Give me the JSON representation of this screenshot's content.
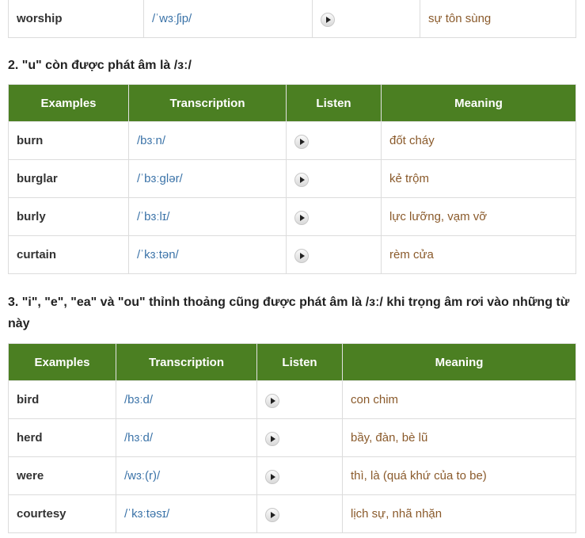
{
  "top_row": {
    "word": "worship",
    "ipa": "/ˈwɜːʃip/",
    "meaning": "sự tôn sùng"
  },
  "section2": {
    "heading": "2. \"u\" còn được phát âm là /ɜː/",
    "headers": [
      "Examples",
      "Transcription",
      "Listen",
      "Meaning"
    ],
    "rows": [
      {
        "word": "burn",
        "ipa": "/bɜːn/",
        "meaning": "đốt cháy"
      },
      {
        "word": "burglar",
        "ipa": "/ˈbɜːglər/",
        "meaning": "kẻ trộm"
      },
      {
        "word": "burly",
        "ipa": "/ˈbɜːlɪ/",
        "meaning": "lực lưỡng, vạm vỡ"
      },
      {
        "word": "curtain",
        "ipa": "/ˈkɜːtən/",
        "meaning": "rèm cửa"
      }
    ]
  },
  "section3": {
    "heading": "3. \"i\", \"e\", \"ea\" và \"ou\" thỉnh thoảng cũng được phát âm là /ɜː/ khi trọng âm rơi vào những từ này",
    "headers": [
      "Examples",
      "Transcription",
      "Listen",
      "Meaning"
    ],
    "rows": [
      {
        "word": "bird",
        "ipa": "/bɜːd/",
        "meaning": "con chim"
      },
      {
        "word": "herd",
        "ipa": "/hɜːd/",
        "meaning": "bầy, đàn, bè lũ"
      },
      {
        "word": "were",
        "ipa": "/wɜː(r)/",
        "meaning": "thì, là (quá khứ của to be)"
      },
      {
        "word": "courtesy",
        "ipa": "/ˈkɜːtəsɪ/",
        "meaning": "lịch sự, nhã nhặn"
      }
    ]
  },
  "icons": {
    "play": "play-icon"
  }
}
